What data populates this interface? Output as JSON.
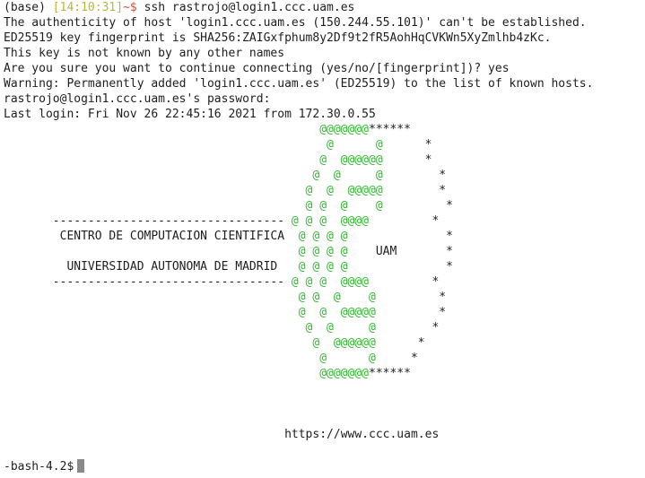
{
  "session": {
    "prompt_prefix": "(base) ",
    "prompt_time": "[14:10:31]",
    "prompt_suffix": "~$ ",
    "command": "ssh rastrojo@login1.ccc.uam.es"
  },
  "output": [
    "The authenticity of host 'login1.ccc.uam.es (150.244.55.101)' can't be established.",
    "ED25519 key fingerprint is SHA256:ZAIGxfphum8y2Df9t2fR5AohHqCVKWn5XyZmlhb4zKc.",
    "This key is not known by any other names",
    "Are you sure you want to continue connecting (yes/no/[fingerprint])? yes",
    "Warning: Permanently added 'login1.ccc.uam.es' (ED25519) to the list of known hosts.",
    "rastrojo@login1.ccc.uam.es's password:",
    "Last login: Fri Nov 26 22:45:16 2021 from 172.30.0.55"
  ],
  "banner": [
    {
      "pre": "                                             ",
      "g": "@@@@@@@",
      "post": "******"
    },
    {
      "pre": "                                              ",
      "g": "@      @",
      "post": "      *"
    },
    {
      "pre": "                                             ",
      "g": "@  @@@@@@",
      "post": "      *"
    },
    {
      "pre": "                                            ",
      "g": "@  @     @",
      "post": "        *"
    },
    {
      "pre": "                                           ",
      "g": "@  @  @@@@@",
      "post": "        *"
    },
    {
      "pre": "                                           ",
      "g": "@ @  @    @",
      "post": "         *"
    },
    {
      "pre": "       --------------------------------- ",
      "g": "@ @ @  @@@@",
      "post": "         *"
    },
    {
      "pre": "        CENTRO DE COMPUTACION CIENTIFICA  ",
      "g": "@ @ @ @",
      "post": "              *"
    },
    {
      "pre": "                                          ",
      "g": "@ @ @ @",
      "post": "    UAM       *"
    },
    {
      "pre": "         UNIVERSIDAD AUTONOMA DE MADRID   ",
      "g": "@ @ @ @",
      "post": "              *"
    },
    {
      "pre": "       --------------------------------- ",
      "g": "@ @ @  @@@@",
      "post": "         *"
    },
    {
      "pre": "                                          ",
      "g": "@ @  @    @",
      "post": "         *"
    },
    {
      "pre": "                                          ",
      "g": "@  @  @@@@@",
      "post": "         *"
    },
    {
      "pre": "                                           ",
      "g": "@  @     @",
      "post": "        *"
    },
    {
      "pre": "                                            ",
      "g": "@  @@@@@@",
      "post": "      *"
    },
    {
      "pre": "                                             ",
      "g": "@      @",
      "post": "     *"
    },
    {
      "pre": "                                             ",
      "g": "@@@@@@@",
      "post": "******"
    }
  ],
  "url": "https://www.ccc.uam.es",
  "final_prompt": "-bash-4.2$"
}
